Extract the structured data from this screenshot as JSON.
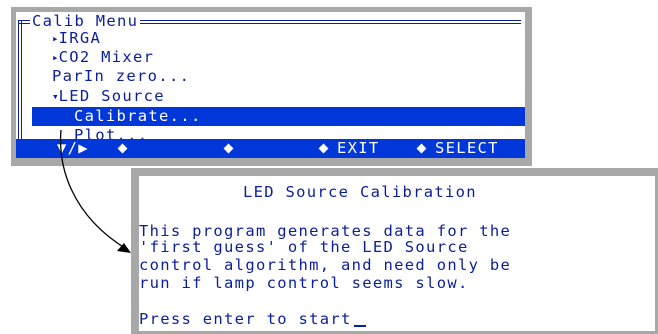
{
  "menu": {
    "title": "Calib Menu",
    "items": [
      {
        "marker": "▸",
        "label": "IRGA"
      },
      {
        "marker": "▸",
        "label": "CO2 Mixer"
      },
      {
        "marker": "",
        "label": "ParIn zero..."
      },
      {
        "marker": "▾",
        "label": "LED Source"
      }
    ],
    "sub_items": [
      {
        "label": "Calibrate...",
        "selected": true
      },
      {
        "label": "Plot..."
      }
    ],
    "fkeys": {
      "f1": "▼/▶",
      "f5": "EXIT",
      "f6": "SELECT"
    }
  },
  "dialog": {
    "title": "LED Source Calibration",
    "body_lines": [
      "This program generates data for the",
      "'first guess' of the LED Source",
      "control algorithm, and need only be",
      "run if lamp control seems slow."
    ],
    "prompt": "Press enter to start"
  },
  "colors": {
    "text": "#0a1f9c",
    "highlight": "#0037d8",
    "frame": "#a8a8a8"
  }
}
